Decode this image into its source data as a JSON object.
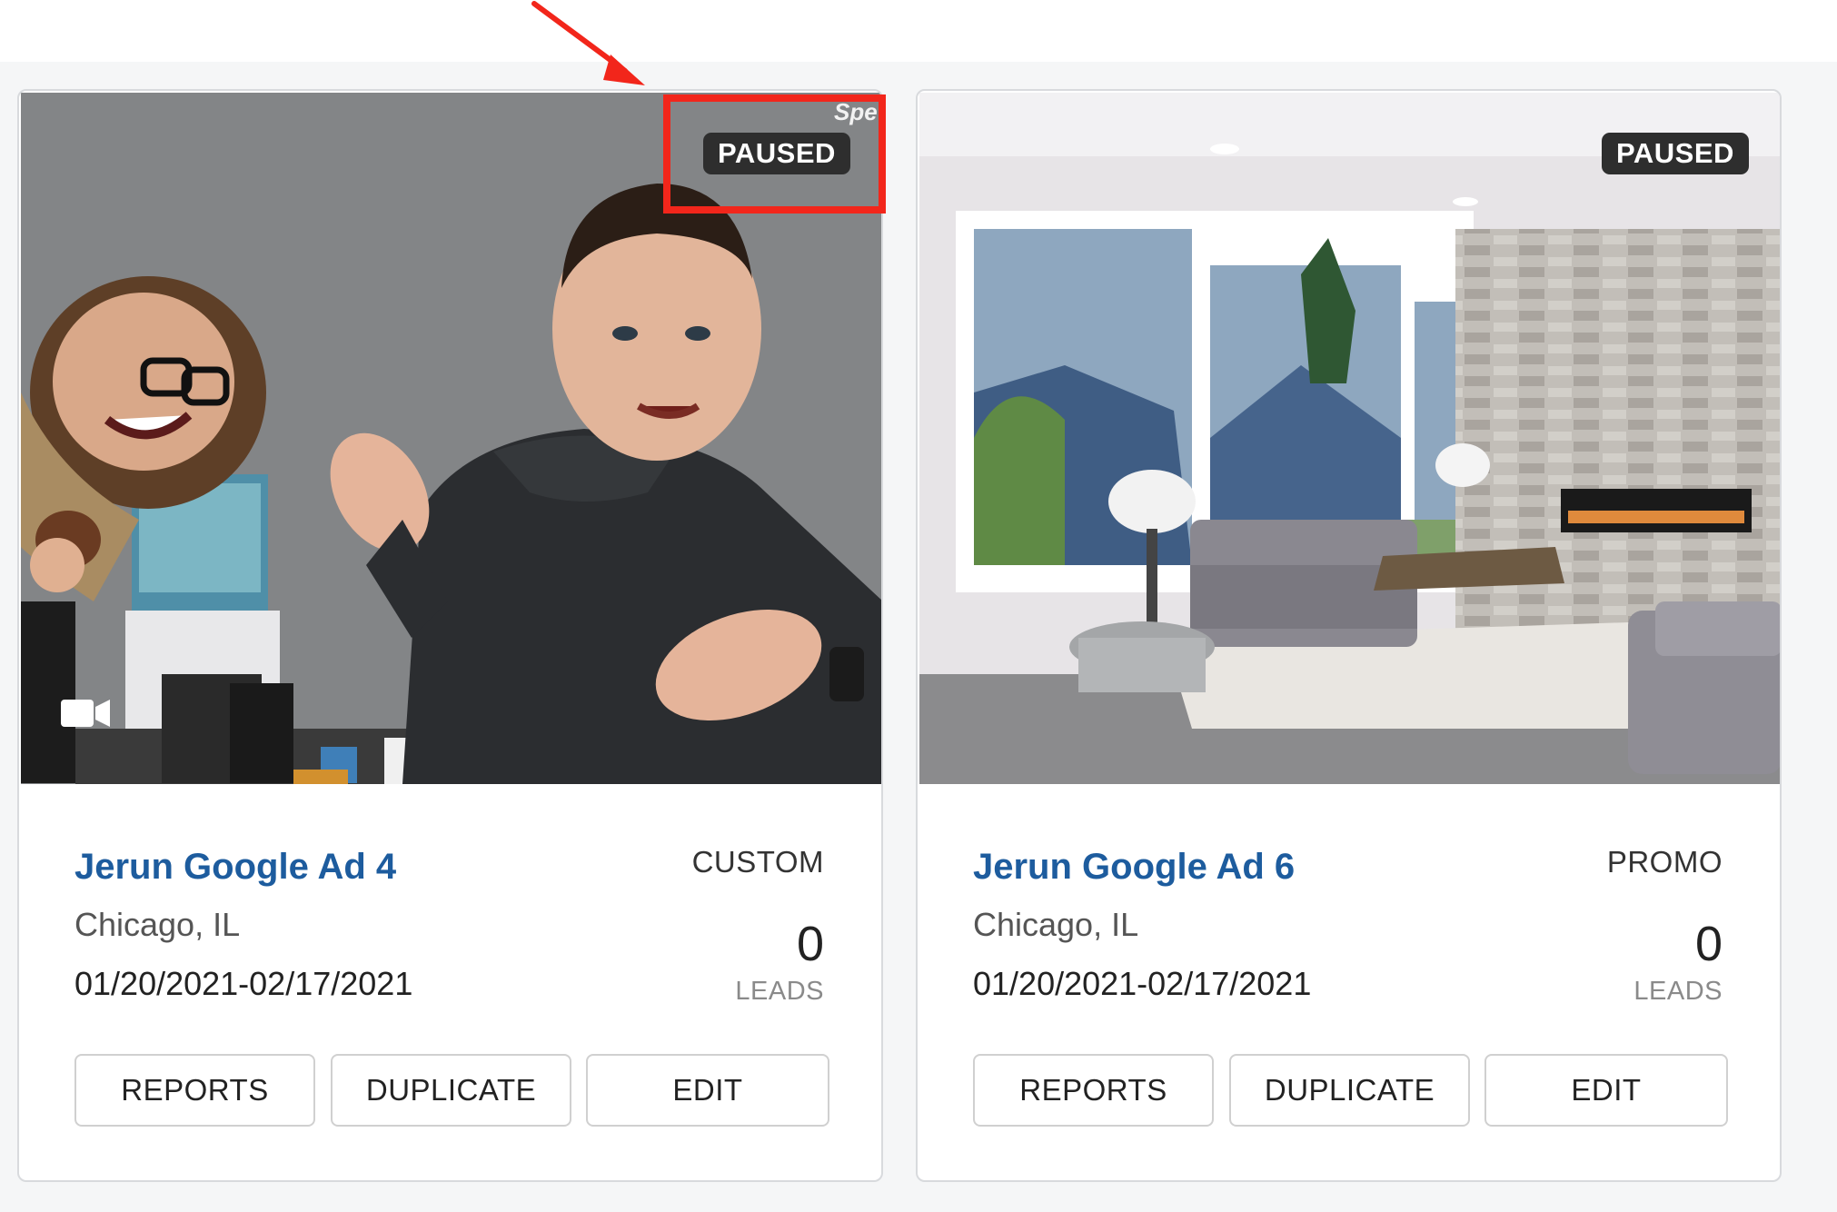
{
  "colors": {
    "accent": "#1d5c9e",
    "badge_bg": "#2e2e2e",
    "highlight": "#f2261b"
  },
  "cards": [
    {
      "status": "PAUSED",
      "title": "Jerun Google Ad 4",
      "type": "CUSTOM",
      "location": "Chicago, IL",
      "dates": "01/20/2021-02/17/2021",
      "leads_count": "0",
      "leads_label": "LEADS",
      "media_icon": "video-camera-icon",
      "buttons": {
        "reports": "REPORTS",
        "duplicate": "DUPLICATE",
        "edit": "EDIT"
      }
    },
    {
      "status": "PAUSED",
      "title": "Jerun Google Ad 6",
      "type": "PROMO",
      "location": "Chicago, IL",
      "dates": "01/20/2021-02/17/2021",
      "leads_count": "0",
      "leads_label": "LEADS",
      "buttons": {
        "reports": "REPORTS",
        "duplicate": "DUPLICATE",
        "edit": "EDIT"
      }
    }
  ]
}
